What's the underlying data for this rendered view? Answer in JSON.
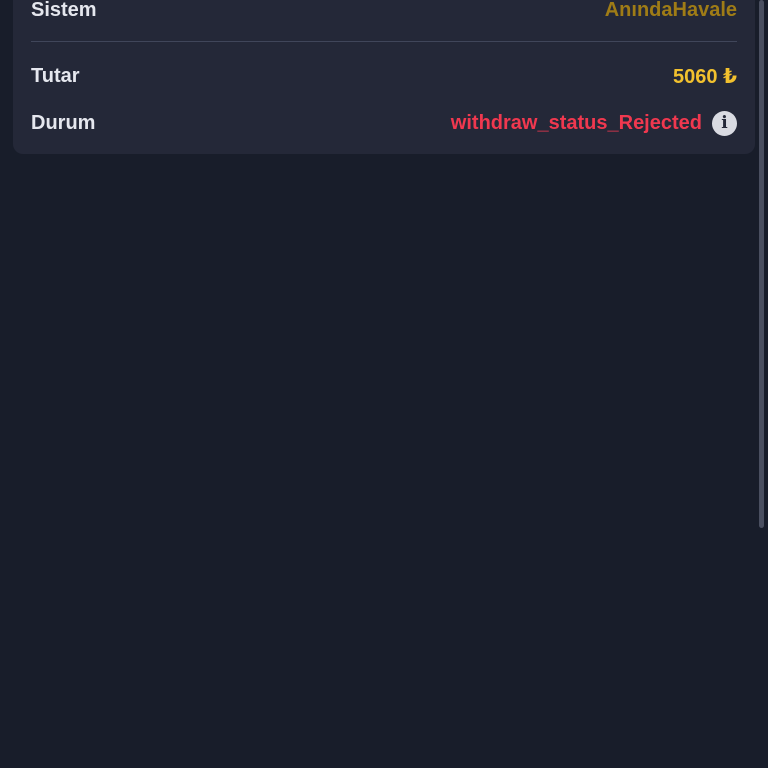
{
  "details": {
    "system_label": "Sistem",
    "system_value": "AnındaHavale",
    "amount_label": "Tutar",
    "amount_value": "5060 ₺",
    "status_label": "Durum",
    "status_value": "withdraw_status_Rejected"
  },
  "icons": {
    "status_info": "info-icon"
  },
  "colors": {
    "background": "#181d2a",
    "card": "#242838",
    "system_value": "#9f7c16",
    "amount_value": "#f2c12e",
    "status_rejected": "#f0384f"
  }
}
